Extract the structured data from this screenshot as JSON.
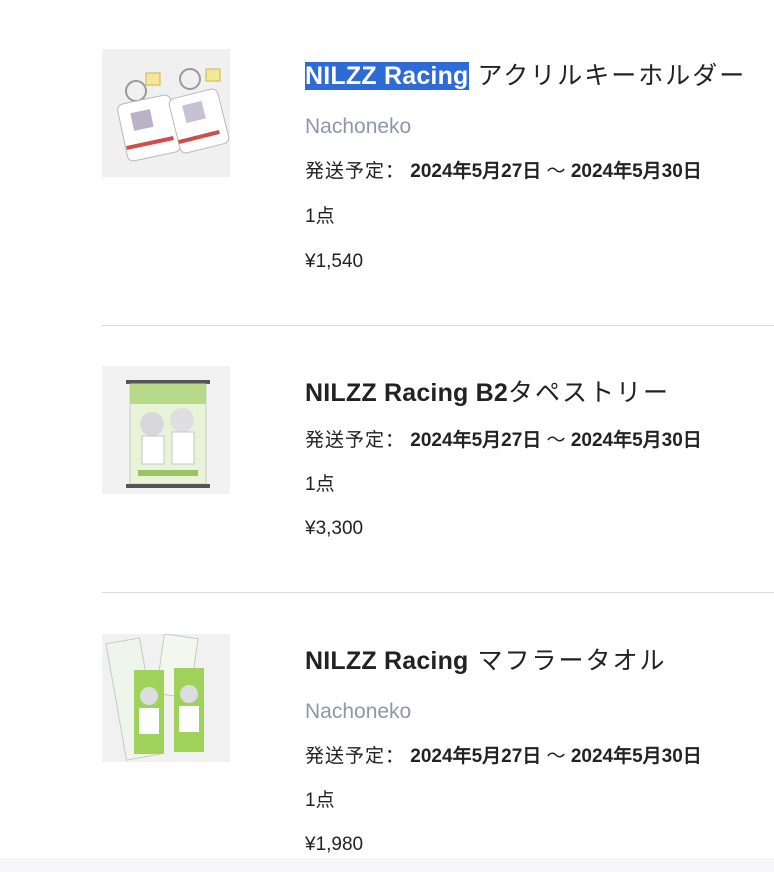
{
  "items": [
    {
      "title_highlight": "NILZZ Racing",
      "title_rest": " アクリルキーホルダー",
      "artist": "Nachoneko",
      "ship_label": "発送予定：",
      "ship_from": "2024年5月27日",
      "ship_sep": "～",
      "ship_to": "2024年5月30日",
      "quantity": "1点",
      "price": "¥1,540",
      "image_icon": "acrylic-keychain-image"
    },
    {
      "title_main": "NILZZ Racing B2",
      "title_rest": "タペストリー",
      "ship_label": "発送予定：",
      "ship_from": "2024年5月27日",
      "ship_sep": "～",
      "ship_to": "2024年5月30日",
      "quantity": "1点",
      "price": "¥3,300",
      "image_icon": "tapestry-image"
    },
    {
      "title_main": "NILZZ Racing",
      "title_rest": " マフラータオル",
      "artist": "Nachoneko",
      "ship_label": "発送予定：",
      "ship_from": "2024年5月27日",
      "ship_sep": "～",
      "ship_to": "2024年5月30日",
      "quantity": "1点",
      "price": "¥1,980",
      "image_icon": "muffler-towel-image"
    }
  ],
  "colors": {
    "highlight": "#2f6bd6",
    "artist": "#8e97a8",
    "divider": "#d9d9d9"
  }
}
